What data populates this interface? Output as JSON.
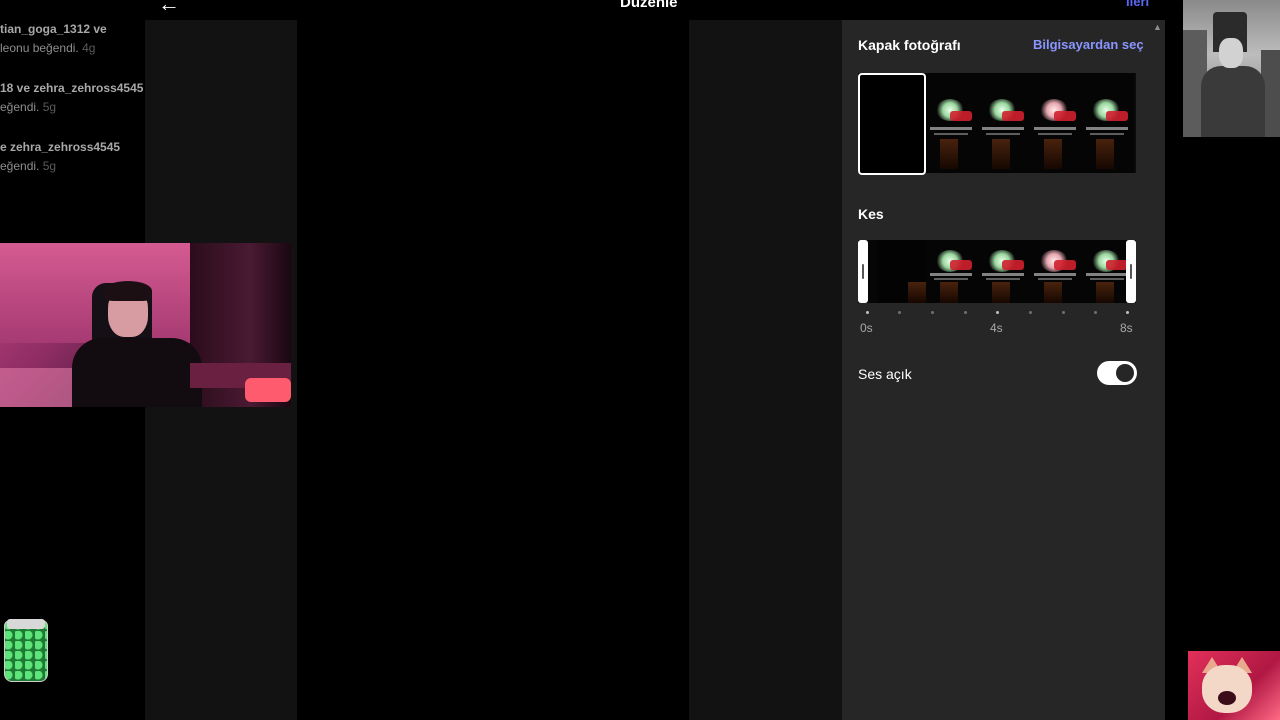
{
  "header": {
    "title": "Düzenle",
    "next_label": "İleri"
  },
  "notifications": [
    {
      "user_line": "tian_goga_1312 ve",
      "action": "leonu beğendi.",
      "time": "4g"
    },
    {
      "user_line": "18 ve zehra_zehross4545",
      "action": "eğendi.",
      "time": "5g"
    },
    {
      "user_line": "e zehra_zehross4545",
      "action": "eğendi.",
      "time": "5g"
    }
  ],
  "cover": {
    "title": "Kapak fotoğrafı",
    "choose_from_computer": "Bilgisayardan seç"
  },
  "trim": {
    "title": "Kes",
    "ticks": [
      "0s",
      "4s",
      "8s"
    ]
  },
  "sound": {
    "label": "Ses açık",
    "enabled": true
  },
  "colors": {
    "panel": "#262626",
    "link": "#8a96ff",
    "toggle_on": "#ffffff"
  }
}
